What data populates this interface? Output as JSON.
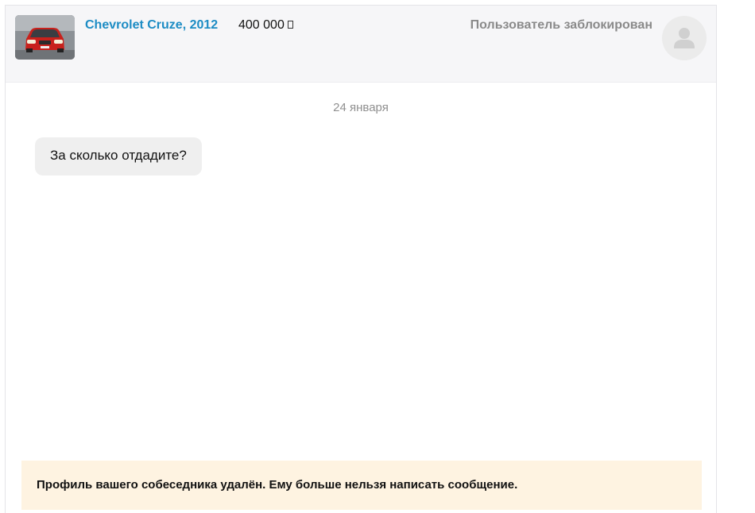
{
  "header": {
    "ad_title": "Chevrolet Cruze, 2012",
    "ad_price": "400 000",
    "currency_icon": "ruble-icon",
    "user_status": "Пользователь заблокирован",
    "avatar_icon": "user-silhouette-icon",
    "thumb_icon": "red-car-photo",
    "colors": {
      "title_link": "#1c8cc4",
      "status_text": "#8a8a8a",
      "header_bg": "#f6f6f8"
    }
  },
  "conversation": {
    "date_label": "24 января",
    "messages": [
      {
        "text": "За сколько отдадите?"
      }
    ]
  },
  "notice": {
    "text": "Профиль вашего собеседника удалён. Ему больше нельзя написать сообщение.",
    "bg_color": "#fef3e1"
  }
}
